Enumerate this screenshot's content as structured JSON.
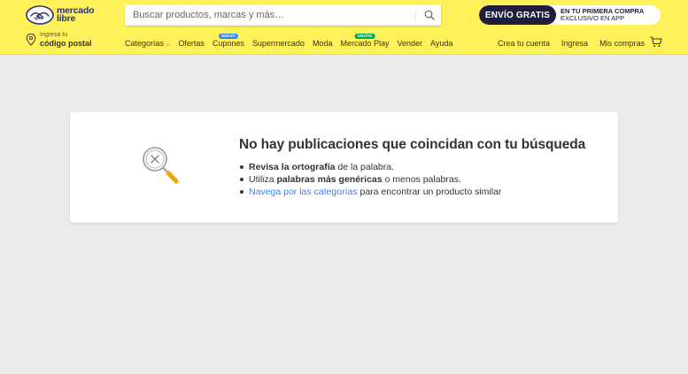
{
  "brand": {
    "line1": "mercado",
    "line2": "libre",
    "color": "#2d3277"
  },
  "header": {
    "bg_color": "#fff159"
  },
  "search": {
    "placeholder": "Buscar productos, marcas y más…",
    "value": "",
    "button_icon": "search-icon"
  },
  "promo": {
    "left": "ENVÍO GRATIS",
    "right_line1_prefix": "EN TU ",
    "right_line1_strong": "PRIMERA COMPRA",
    "right_line2": "EXCLUSIVO EN APP"
  },
  "location": {
    "small": "Ingresa tu",
    "big": "código postal",
    "icon": "location-pin-icon"
  },
  "nav": {
    "items": [
      {
        "label": "Categorías",
        "has_chevron": true
      },
      {
        "label": "Ofertas"
      },
      {
        "label": "Cupones",
        "badge": "NUEVO"
      },
      {
        "label": "Supermercado"
      },
      {
        "label": "Moda"
      },
      {
        "label": "Mercado Play",
        "badge": "GRATIS"
      },
      {
        "label": "Vender"
      },
      {
        "label": "Ayuda"
      }
    ],
    "chevron": "⌵"
  },
  "account": {
    "create": "Crea tu cuenta",
    "login": "Ingresa",
    "purchases": "Mis compras",
    "cart_icon": "cart-icon"
  },
  "empty_state": {
    "title": "No hay publicaciones que coincidan con tu búsqueda",
    "illustration": "magnifier-no-results-icon",
    "tips": [
      {
        "strong": "Revisa la ortografía",
        "rest": " de la palabra."
      },
      {
        "pre": "Utiliza ",
        "strong": "palabras más genéricas",
        "rest": " o menos palabras."
      },
      {
        "link": "Navega por las categorías",
        "rest": " para encontrar un producto similar"
      }
    ]
  },
  "colors": {
    "link": "#3483fa",
    "badge_blue": "#3483fa",
    "badge_green": "#00a650",
    "page_bg": "#ebebeb"
  }
}
